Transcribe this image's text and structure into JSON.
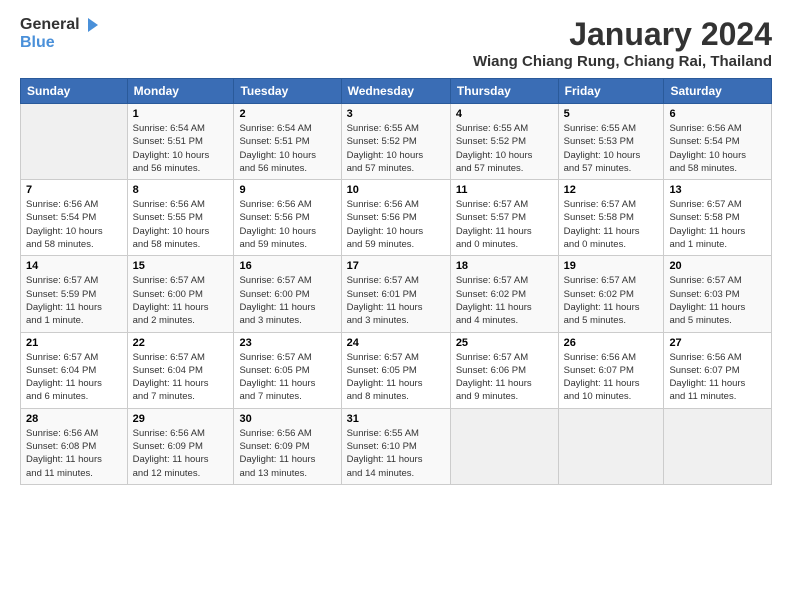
{
  "logo": {
    "line1": "General",
    "line2": "Blue"
  },
  "title": "January 2024",
  "location": "Wiang Chiang Rung, Chiang Rai, Thailand",
  "days_of_week": [
    "Sunday",
    "Monday",
    "Tuesday",
    "Wednesday",
    "Thursday",
    "Friday",
    "Saturday"
  ],
  "weeks": [
    [
      {
        "day": "",
        "info": ""
      },
      {
        "day": "1",
        "info": "Sunrise: 6:54 AM\nSunset: 5:51 PM\nDaylight: 10 hours\nand 56 minutes."
      },
      {
        "day": "2",
        "info": "Sunrise: 6:54 AM\nSunset: 5:51 PM\nDaylight: 10 hours\nand 56 minutes."
      },
      {
        "day": "3",
        "info": "Sunrise: 6:55 AM\nSunset: 5:52 PM\nDaylight: 10 hours\nand 57 minutes."
      },
      {
        "day": "4",
        "info": "Sunrise: 6:55 AM\nSunset: 5:52 PM\nDaylight: 10 hours\nand 57 minutes."
      },
      {
        "day": "5",
        "info": "Sunrise: 6:55 AM\nSunset: 5:53 PM\nDaylight: 10 hours\nand 57 minutes."
      },
      {
        "day": "6",
        "info": "Sunrise: 6:56 AM\nSunset: 5:54 PM\nDaylight: 10 hours\nand 58 minutes."
      }
    ],
    [
      {
        "day": "7",
        "info": "Sunrise: 6:56 AM\nSunset: 5:54 PM\nDaylight: 10 hours\nand 58 minutes."
      },
      {
        "day": "8",
        "info": "Sunrise: 6:56 AM\nSunset: 5:55 PM\nDaylight: 10 hours\nand 58 minutes."
      },
      {
        "day": "9",
        "info": "Sunrise: 6:56 AM\nSunset: 5:56 PM\nDaylight: 10 hours\nand 59 minutes."
      },
      {
        "day": "10",
        "info": "Sunrise: 6:56 AM\nSunset: 5:56 PM\nDaylight: 10 hours\nand 59 minutes."
      },
      {
        "day": "11",
        "info": "Sunrise: 6:57 AM\nSunset: 5:57 PM\nDaylight: 11 hours\nand 0 minutes."
      },
      {
        "day": "12",
        "info": "Sunrise: 6:57 AM\nSunset: 5:58 PM\nDaylight: 11 hours\nand 0 minutes."
      },
      {
        "day": "13",
        "info": "Sunrise: 6:57 AM\nSunset: 5:58 PM\nDaylight: 11 hours\nand 1 minute."
      }
    ],
    [
      {
        "day": "14",
        "info": "Sunrise: 6:57 AM\nSunset: 5:59 PM\nDaylight: 11 hours\nand 1 minute."
      },
      {
        "day": "15",
        "info": "Sunrise: 6:57 AM\nSunset: 6:00 PM\nDaylight: 11 hours\nand 2 minutes."
      },
      {
        "day": "16",
        "info": "Sunrise: 6:57 AM\nSunset: 6:00 PM\nDaylight: 11 hours\nand 3 minutes."
      },
      {
        "day": "17",
        "info": "Sunrise: 6:57 AM\nSunset: 6:01 PM\nDaylight: 11 hours\nand 3 minutes."
      },
      {
        "day": "18",
        "info": "Sunrise: 6:57 AM\nSunset: 6:02 PM\nDaylight: 11 hours\nand 4 minutes."
      },
      {
        "day": "19",
        "info": "Sunrise: 6:57 AM\nSunset: 6:02 PM\nDaylight: 11 hours\nand 5 minutes."
      },
      {
        "day": "20",
        "info": "Sunrise: 6:57 AM\nSunset: 6:03 PM\nDaylight: 11 hours\nand 5 minutes."
      }
    ],
    [
      {
        "day": "21",
        "info": "Sunrise: 6:57 AM\nSunset: 6:04 PM\nDaylight: 11 hours\nand 6 minutes."
      },
      {
        "day": "22",
        "info": "Sunrise: 6:57 AM\nSunset: 6:04 PM\nDaylight: 11 hours\nand 7 minutes."
      },
      {
        "day": "23",
        "info": "Sunrise: 6:57 AM\nSunset: 6:05 PM\nDaylight: 11 hours\nand 7 minutes."
      },
      {
        "day": "24",
        "info": "Sunrise: 6:57 AM\nSunset: 6:05 PM\nDaylight: 11 hours\nand 8 minutes."
      },
      {
        "day": "25",
        "info": "Sunrise: 6:57 AM\nSunset: 6:06 PM\nDaylight: 11 hours\nand 9 minutes."
      },
      {
        "day": "26",
        "info": "Sunrise: 6:56 AM\nSunset: 6:07 PM\nDaylight: 11 hours\nand 10 minutes."
      },
      {
        "day": "27",
        "info": "Sunrise: 6:56 AM\nSunset: 6:07 PM\nDaylight: 11 hours\nand 11 minutes."
      }
    ],
    [
      {
        "day": "28",
        "info": "Sunrise: 6:56 AM\nSunset: 6:08 PM\nDaylight: 11 hours\nand 11 minutes."
      },
      {
        "day": "29",
        "info": "Sunrise: 6:56 AM\nSunset: 6:09 PM\nDaylight: 11 hours\nand 12 minutes."
      },
      {
        "day": "30",
        "info": "Sunrise: 6:56 AM\nSunset: 6:09 PM\nDaylight: 11 hours\nand 13 minutes."
      },
      {
        "day": "31",
        "info": "Sunrise: 6:55 AM\nSunset: 6:10 PM\nDaylight: 11 hours\nand 14 minutes."
      },
      {
        "day": "",
        "info": ""
      },
      {
        "day": "",
        "info": ""
      },
      {
        "day": "",
        "info": ""
      }
    ]
  ]
}
